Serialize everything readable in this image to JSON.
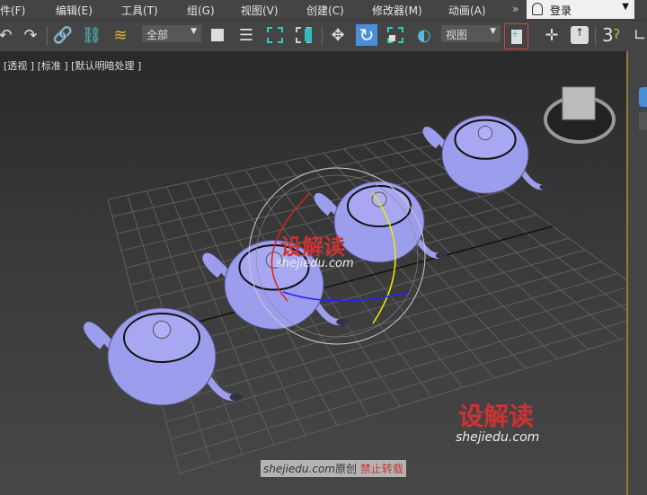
{
  "menu": [
    "件(F)",
    "编辑(E)",
    "工具(T)",
    "组(G)",
    "视图(V)",
    "创建(C)",
    "修改器(M)",
    "动画(A)"
  ],
  "overflow": "»",
  "login": "登录",
  "toolbar": {
    "selection_filter": "全部",
    "ref_coord": "视图",
    "number_label": "3"
  },
  "viewport": {
    "label": "[透视 ] [标准 ] [默认明暗处理 ]"
  },
  "watermark": {
    "brand": "设解读",
    "url": "shejiedu.com"
  },
  "credit": {
    "site": "shejiedu.com",
    "original": "原创",
    "warning": "禁止转载"
  },
  "colors": {
    "teapot": "#9d9ded",
    "active_tool": "#4a8fd8",
    "highlight_border": "#d04040"
  }
}
